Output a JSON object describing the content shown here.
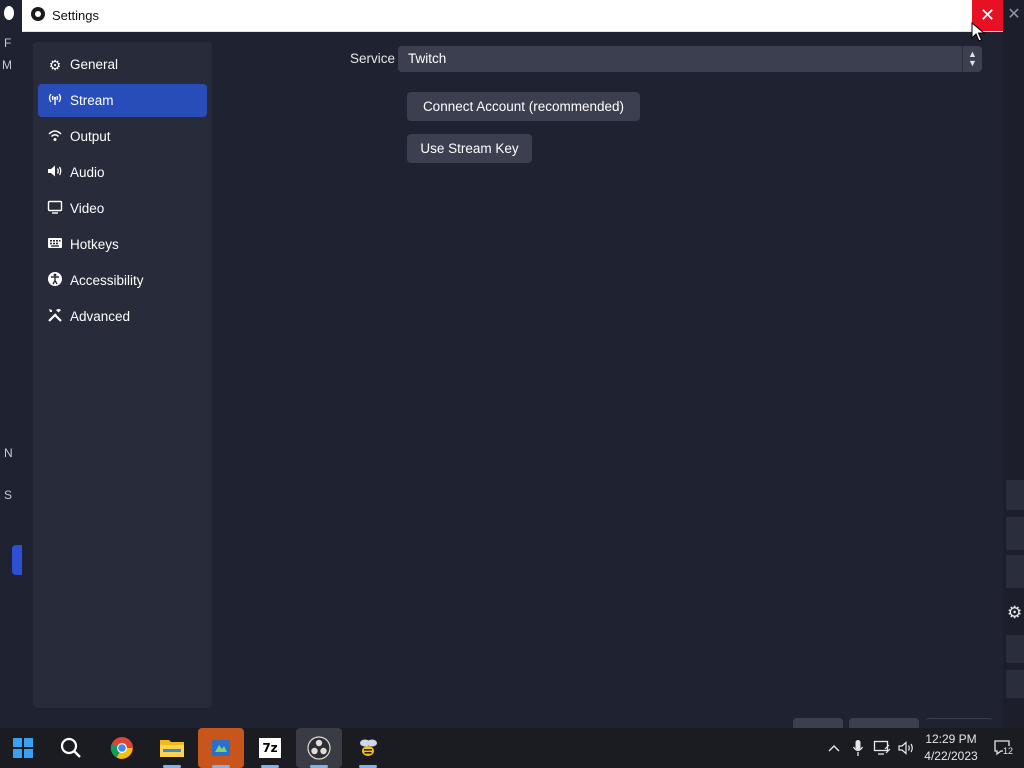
{
  "window": {
    "title": "Settings",
    "close_glyph": "✕"
  },
  "background_window": {
    "left_glyphs": [
      "F",
      "M",
      "N",
      "S"
    ],
    "right_close_glyph": "✕"
  },
  "sidebar": {
    "items": [
      {
        "label": "General",
        "icon": "gear-icon",
        "glyph": "⚙",
        "active": false
      },
      {
        "label": "Stream",
        "icon": "antenna-icon",
        "glyph": "¥",
        "active": true
      },
      {
        "label": "Output",
        "icon": "wifi-icon",
        "glyph": "◠",
        "active": false
      },
      {
        "label": "Audio",
        "icon": "speaker-icon",
        "glyph": "🔊",
        "active": false
      },
      {
        "label": "Video",
        "icon": "monitor-icon",
        "glyph": "▭",
        "active": false
      },
      {
        "label": "Hotkeys",
        "icon": "keyboard-icon",
        "glyph": "⌨",
        "active": false
      },
      {
        "label": "Accessibility",
        "icon": "accessibility-icon",
        "glyph": "♿",
        "active": false
      },
      {
        "label": "Advanced",
        "icon": "tools-icon",
        "glyph": "⚒",
        "active": false
      }
    ]
  },
  "stream": {
    "service_label": "Service",
    "service_value": "Twitch",
    "connect_button": "Connect Account (recommended)",
    "stream_key_button": "Use Stream Key"
  },
  "taskbar": {
    "apps": [
      {
        "name": "start-button",
        "glyph": ""
      },
      {
        "name": "search-icon",
        "glyph": "⌕"
      },
      {
        "name": "chrome-icon",
        "glyph": "◉"
      },
      {
        "name": "file-explorer-icon",
        "glyph": "▤"
      },
      {
        "name": "app-orange-icon",
        "glyph": "❖"
      },
      {
        "name": "7zip-icon",
        "glyph": "7z"
      },
      {
        "name": "obs-icon",
        "glyph": "◎"
      },
      {
        "name": "bee-app-icon",
        "glyph": "❀"
      }
    ],
    "tray": {
      "chevron": "^",
      "mic": "🎙",
      "network": "⎕",
      "volume": "🔉"
    },
    "clock_time": "12:29 PM",
    "clock_date": "4/22/2023",
    "notification_count": "12"
  },
  "colors": {
    "accent": "#284cb8",
    "close_red": "#e81123",
    "surface": "#3b3f50",
    "background": "#1f2230"
  }
}
